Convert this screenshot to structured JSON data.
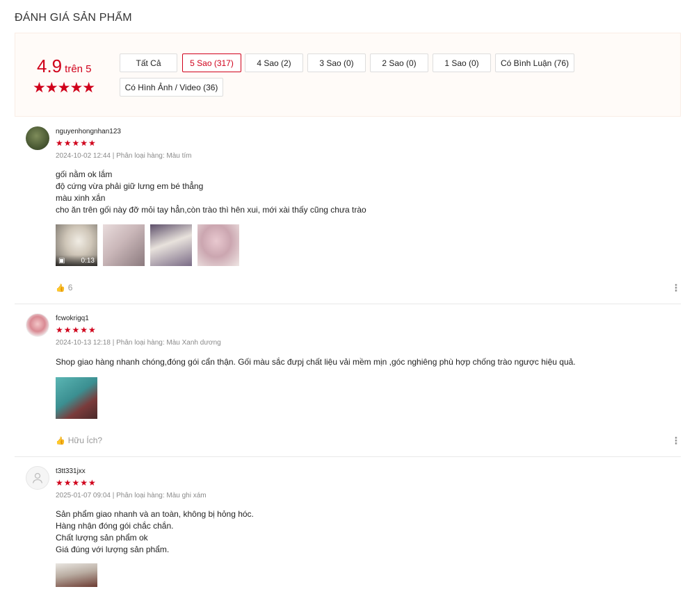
{
  "section": {
    "title": "ĐÁNH GIÁ SẢN PHẨM"
  },
  "overview": {
    "score": "4.9",
    "score_suffix": "trên 5",
    "stars": "★★★★★",
    "rating": 4.9,
    "filters": [
      "Tất Cả",
      "5 Sao (317)",
      "4 Sao (2)",
      "3 Sao (0)",
      "2 Sao (0)",
      "1 Sao (0)",
      "Có Bình Luận (76)",
      "Có Hình Ảnh / Video (36)"
    ],
    "active_filter": "5 Sao (317)"
  },
  "reviews": [
    {
      "username": "nguyenhongnhan123",
      "stars": "★★★★★",
      "meta": "2024-10-02 12:44 | Phân loại hàng: Màu tím",
      "lines": [
        "gối nằm ok lắm",
        "độ cứng vừa phải giữ lưng em bé thẳng",
        "màu xinh xắn",
        "cho ăn trên gối này đỡ mỏi tay hẳn,còn trào thì hên xui, mới xài thấy cũng chưa trào"
      ],
      "video_duration": "0:13",
      "helpful": "6"
    },
    {
      "username": "fcwokrigq1",
      "stars": "★★★★★",
      "meta": "2024-10-13 12:18 | Phân loại hàng: Màu Xanh dương",
      "lines": [
        "Shop giao hàng nhanh chóng,đóng gói cẩn thận. Gối màu sắc đưpj chất liệu vải mềm mịn ,góc nghiêng phù hợp chống trào ngược hiệu quả."
      ],
      "helpful": "Hữu Ích?"
    },
    {
      "username": "t3tt331jxx",
      "stars": "★★★★★",
      "meta": "2025-01-07 09:04 | Phân loại hàng: Màu ghi xám",
      "lines": [
        "Sản phẩm giao nhanh và an toàn, không bị hỏng hóc.",
        "Hàng nhận đóng gói chắc chắn.",
        "Chất lượng sản phẩm ok",
        "Giá đúng với lượng sản phẩm."
      ]
    }
  ],
  "colors": {
    "accent": "#d0011b",
    "overview_bg": "#fffbf8"
  }
}
